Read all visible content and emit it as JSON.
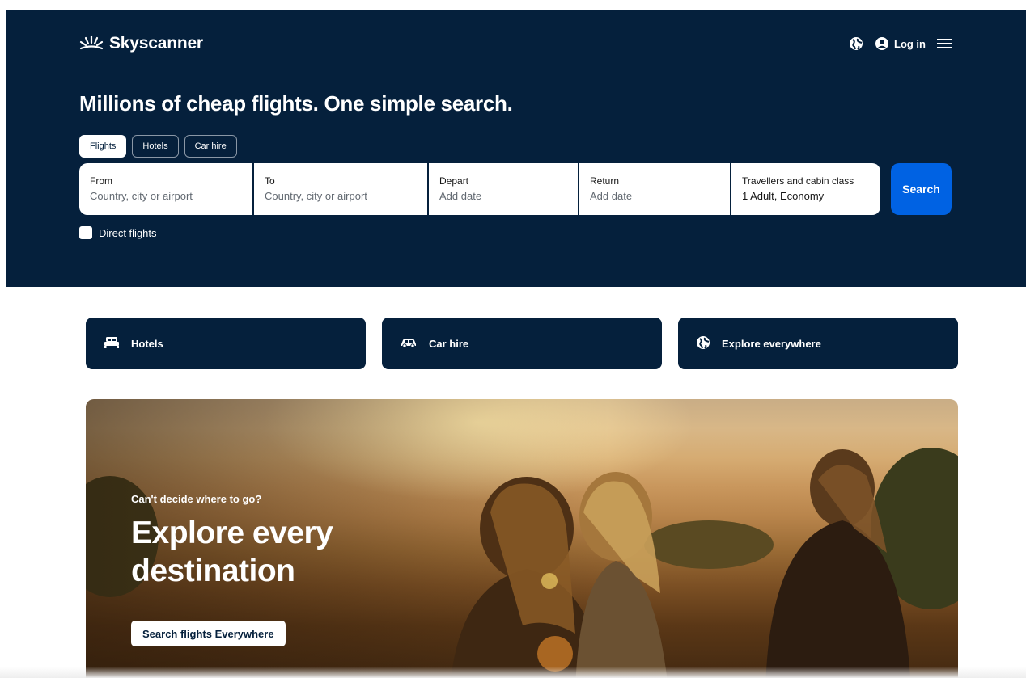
{
  "header": {
    "brand": "Skyscanner",
    "login_label": "Log in",
    "icons": [
      "sun-logo-icon",
      "globe-icon",
      "user-icon",
      "menu-icon"
    ]
  },
  "hero": {
    "headline": "Millions of cheap flights. One simple search.",
    "tabs": [
      {
        "label": "Flights",
        "active": true
      },
      {
        "label": "Hotels",
        "active": false
      },
      {
        "label": "Car hire",
        "active": false
      }
    ],
    "fields": {
      "from": {
        "label": "From",
        "placeholder": "Country, city or airport"
      },
      "to": {
        "label": "To",
        "placeholder": "Country, city or airport"
      },
      "depart": {
        "label": "Depart",
        "placeholder": "Add date"
      },
      "return": {
        "label": "Return",
        "placeholder": "Add date"
      },
      "travellers": {
        "label": "Travellers and cabin class",
        "value": "1 Adult, Economy"
      }
    },
    "search_label": "Search",
    "direct_flights_label": "Direct flights",
    "direct_flights_checked": false
  },
  "quick_links": [
    {
      "label": "Hotels",
      "icon": "bed-icon"
    },
    {
      "label": "Car hire",
      "icon": "car-icon"
    },
    {
      "label": "Explore everywhere",
      "icon": "globe-icon"
    }
  ],
  "banner": {
    "kicker": "Can't decide where to go?",
    "title": "Explore every destination",
    "cta_label": "Search flights Everywhere"
  },
  "colors": {
    "navy": "#05203c",
    "accent_blue": "#0062e3",
    "white": "#ffffff"
  }
}
